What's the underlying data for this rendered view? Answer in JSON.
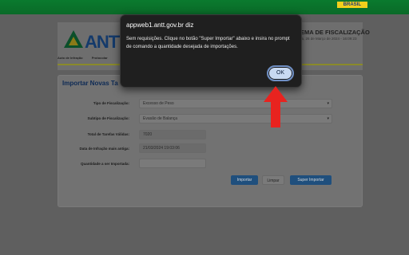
{
  "header": {
    "brasil_label": "BRASIL",
    "logo_text": "ANTT",
    "system_title": "EMA DE FISCALIZAÇÃO",
    "system_date": "ra, 26 de Março de 2024 - 16:09:23",
    "nav_items": [
      "Auto de Infração",
      "Protocolar"
    ]
  },
  "form": {
    "title": "Importar Novas Ta",
    "fields": [
      {
        "label": "Tipo de Fiscalização:",
        "value": "Excesso de Peso"
      },
      {
        "label": "Subtipo de Fiscalização:",
        "value": "Evasão de Balança"
      },
      {
        "label": "Total de Tarefas Válidas:",
        "value": "7020"
      },
      {
        "label": "Data de Infração mais antiga:",
        "value": "21/03/2024 19:03:06"
      },
      {
        "label": "Quantidade a ser Importada:",
        "value": ""
      }
    ],
    "buttons": {
      "import": "Importar",
      "clear": "Limpar",
      "super_import": "Super Importar"
    }
  },
  "dialog": {
    "title": "appweb1.antt.gov.br diz",
    "message": "Sem requisições. Clique no botão \"Super Importar\" abaixo e insira no prompt de comando a quantidade desejada de importações.",
    "ok_label": "OK"
  },
  "colors": {
    "gov_green": "#0a7a2e",
    "brasil_yellow": "#f2cf1c",
    "primary_button": "#1f4f7d",
    "arrow_red": "#e8231f",
    "dialog_bg": "#1f1f1f",
    "ok_button": "#c8d9f2"
  }
}
